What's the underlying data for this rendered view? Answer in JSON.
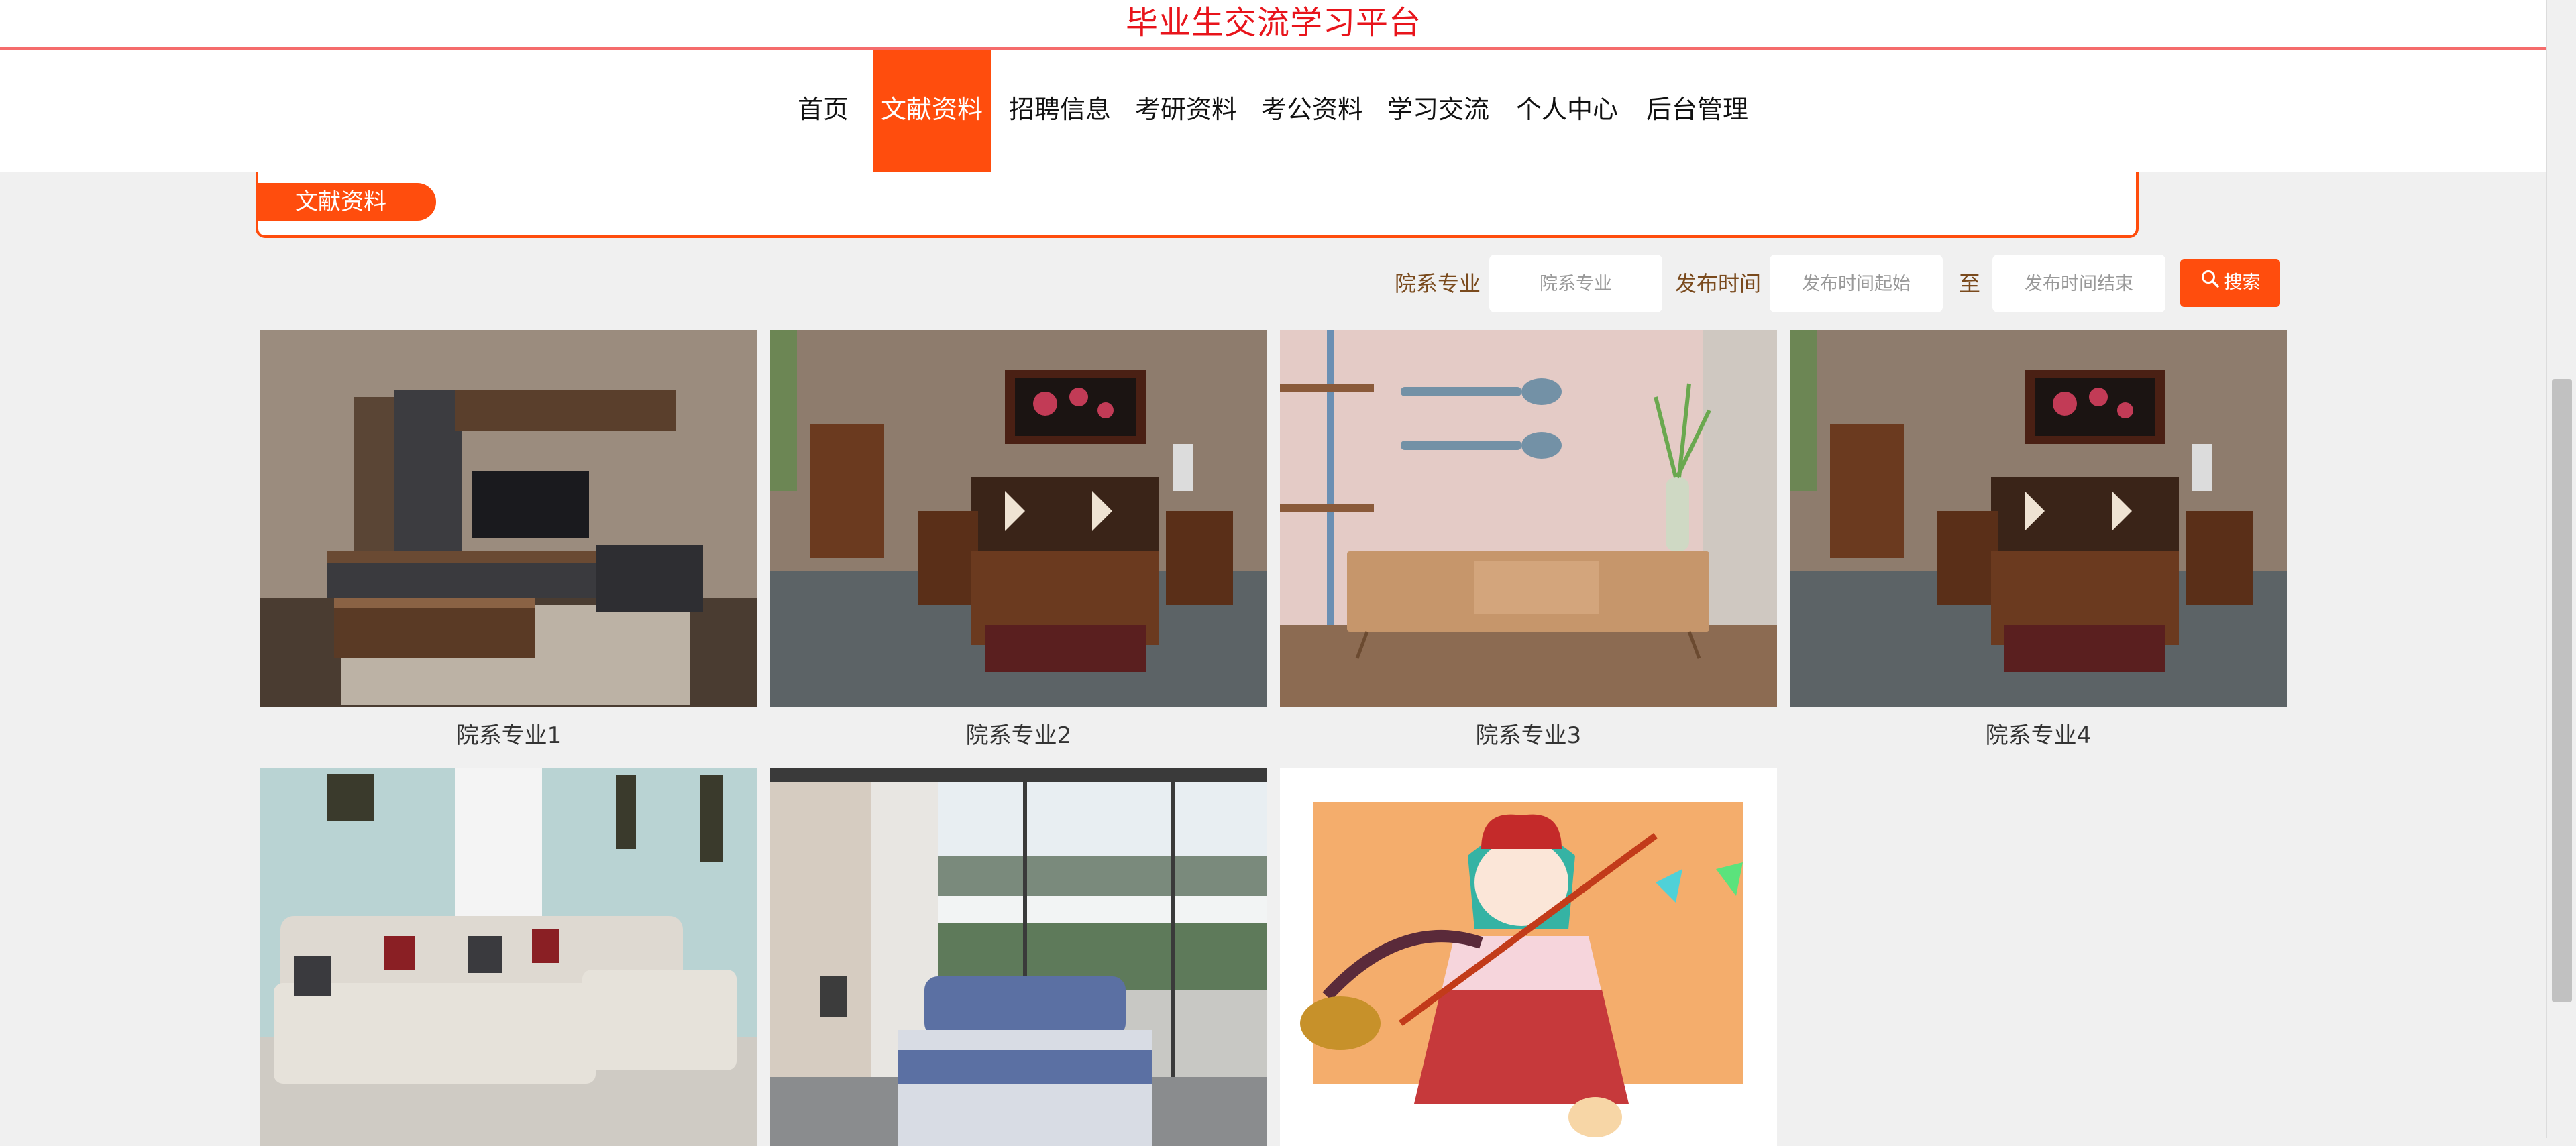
{
  "header": {
    "title": "毕业生交流学习平台"
  },
  "nav": {
    "items": [
      {
        "label": "首页"
      },
      {
        "label": "文献资料"
      },
      {
        "label": "招聘信息"
      },
      {
        "label": "考研资料"
      },
      {
        "label": "考公资料"
      },
      {
        "label": "学习交流"
      },
      {
        "label": "个人中心"
      },
      {
        "label": "后台管理"
      }
    ],
    "active": "文献资料"
  },
  "section": {
    "title": "文献资料"
  },
  "search": {
    "major_label": "院系专业",
    "major_placeholder": "院系专业",
    "time_label": "发布时间",
    "start_placeholder": "发布时间起始",
    "to_label": "至",
    "end_placeholder": "发布时间结束",
    "button_label": "搜索"
  },
  "items": [
    {
      "label": "院系专业1",
      "image": "living-room-tv-wall"
    },
    {
      "label": "院系专业2",
      "image": "chinese-style-living-room"
    },
    {
      "label": "院系专业3",
      "image": "pink-wall-tv-cabinet"
    },
    {
      "label": "院系专业4",
      "image": "chinese-style-living-room"
    },
    {
      "label": "",
      "image": "white-sectional-sofa"
    },
    {
      "label": "",
      "image": "bedroom-lake-view"
    },
    {
      "label": "",
      "image": "anime-character"
    }
  ],
  "colors": {
    "accent": "#ff4d0d",
    "title": "#e8141b",
    "label": "#7a4a1d"
  }
}
